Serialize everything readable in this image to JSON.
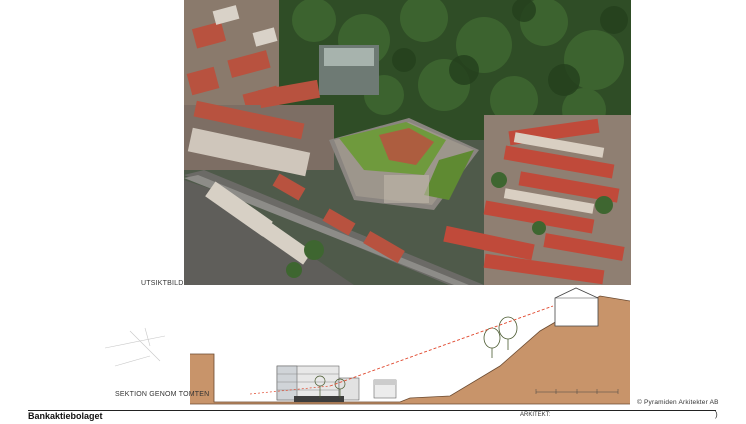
{
  "labels": {
    "aerial": "UTSIKTBILD",
    "section": "SEKTION GENOM TOMTEN",
    "credit": "© Pyramiden Arkitekter AB"
  },
  "footer": {
    "title": "Bankaktiebolaget",
    "architect": "ARKITEKT:",
    "corner_mark": ")"
  },
  "colors": {
    "ground": "#c8946a",
    "sightline": "#e0482e",
    "greenroof": "#6f9a3d",
    "roof_red": "#b8523f"
  }
}
